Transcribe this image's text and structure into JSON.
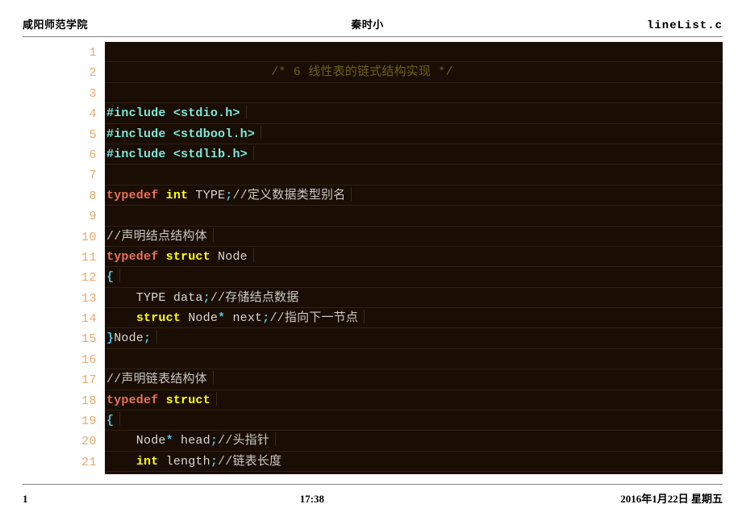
{
  "slide": {
    "header": {
      "left": "咸阳师范学院",
      "center": "秦时小",
      "right": "lineList.c"
    },
    "footer": {
      "page_number": "1",
      "time": "17:38",
      "date": "2016年1月22日 星期五"
    }
  },
  "code": {
    "language": "c",
    "theme": {
      "background": "#1a0d03",
      "gutter_background": "#ffffff",
      "line_number_color": "#e7a769",
      "default_text": "#d8d8d0",
      "preprocessor": "#7fe8dd",
      "keyword": "#ffff00",
      "typedef": "#e8725a",
      "brace": "#4fc3e8",
      "comment": "#c9c9c1",
      "block_comment": "#6b6118"
    },
    "line_numbers": [
      "1",
      "2",
      "3",
      "4",
      "5",
      "6",
      "7",
      "8",
      "9",
      "10",
      "11",
      "12",
      "13",
      "14",
      "15",
      "16",
      "17",
      "18",
      "19",
      "20",
      "21"
    ],
    "lines": {
      "n1": "",
      "n2": "/* 6 线性表的链式结构实现 */",
      "n3": "",
      "n4": "#include <stdio.h>",
      "n5": "#include <stdbool.h>",
      "n6": "#include <stdlib.h>",
      "n7": "",
      "n8": "typedef int TYPE;//定义数据类型别名",
      "n9": "",
      "n10": "//声明结点结构体",
      "n11": "typedef struct Node",
      "n12": "{",
      "n13": "    TYPE data;//存储结点数据",
      "n14": "    struct Node* next;//指向下一节点",
      "n15": "}Node;",
      "n16": "",
      "n17": "//声明链表结构体",
      "n18": "typedef struct",
      "n19": "{",
      "n20": "    Node* head;//头指针",
      "n21": "    int length;//链表长度"
    },
    "tokens": {
      "blockcomment_2": "/* 6 线性表的链式结构实现 */",
      "include_kw": "#include",
      "hdr_stdio": " <stdio.h>",
      "hdr_stdbool": " <stdbool.h>",
      "hdr_stdlib": " <stdlib.h>",
      "kw_typedef": "typedef",
      "kw_int": "int",
      "kw_struct": "struct",
      "id_TYPE": " TYPE",
      "semi": ";",
      "cmt_typedef": "//定义数据类型别名",
      "cmt_node_struct": "//声明结点结构体",
      "id_Node": " Node",
      "brace_open": "{",
      "brace_close": "}",
      "id_TYPE_field": "    TYPE data",
      "cmt_store_data": "//存储结点数据",
      "indent4": "    ",
      "id_Node_ptr": " Node",
      "star": "*",
      "id_next": " next",
      "cmt_next_node": "//指向下一节点",
      "id_Node_name": "Node",
      "cmt_list_struct": "//声明链表结构体",
      "id_Node_head": "    Node",
      "id_head": " head",
      "cmt_head_ptr": "//头指针",
      "id_length": " length",
      "cmt_list_len": "//链表长度"
    }
  }
}
